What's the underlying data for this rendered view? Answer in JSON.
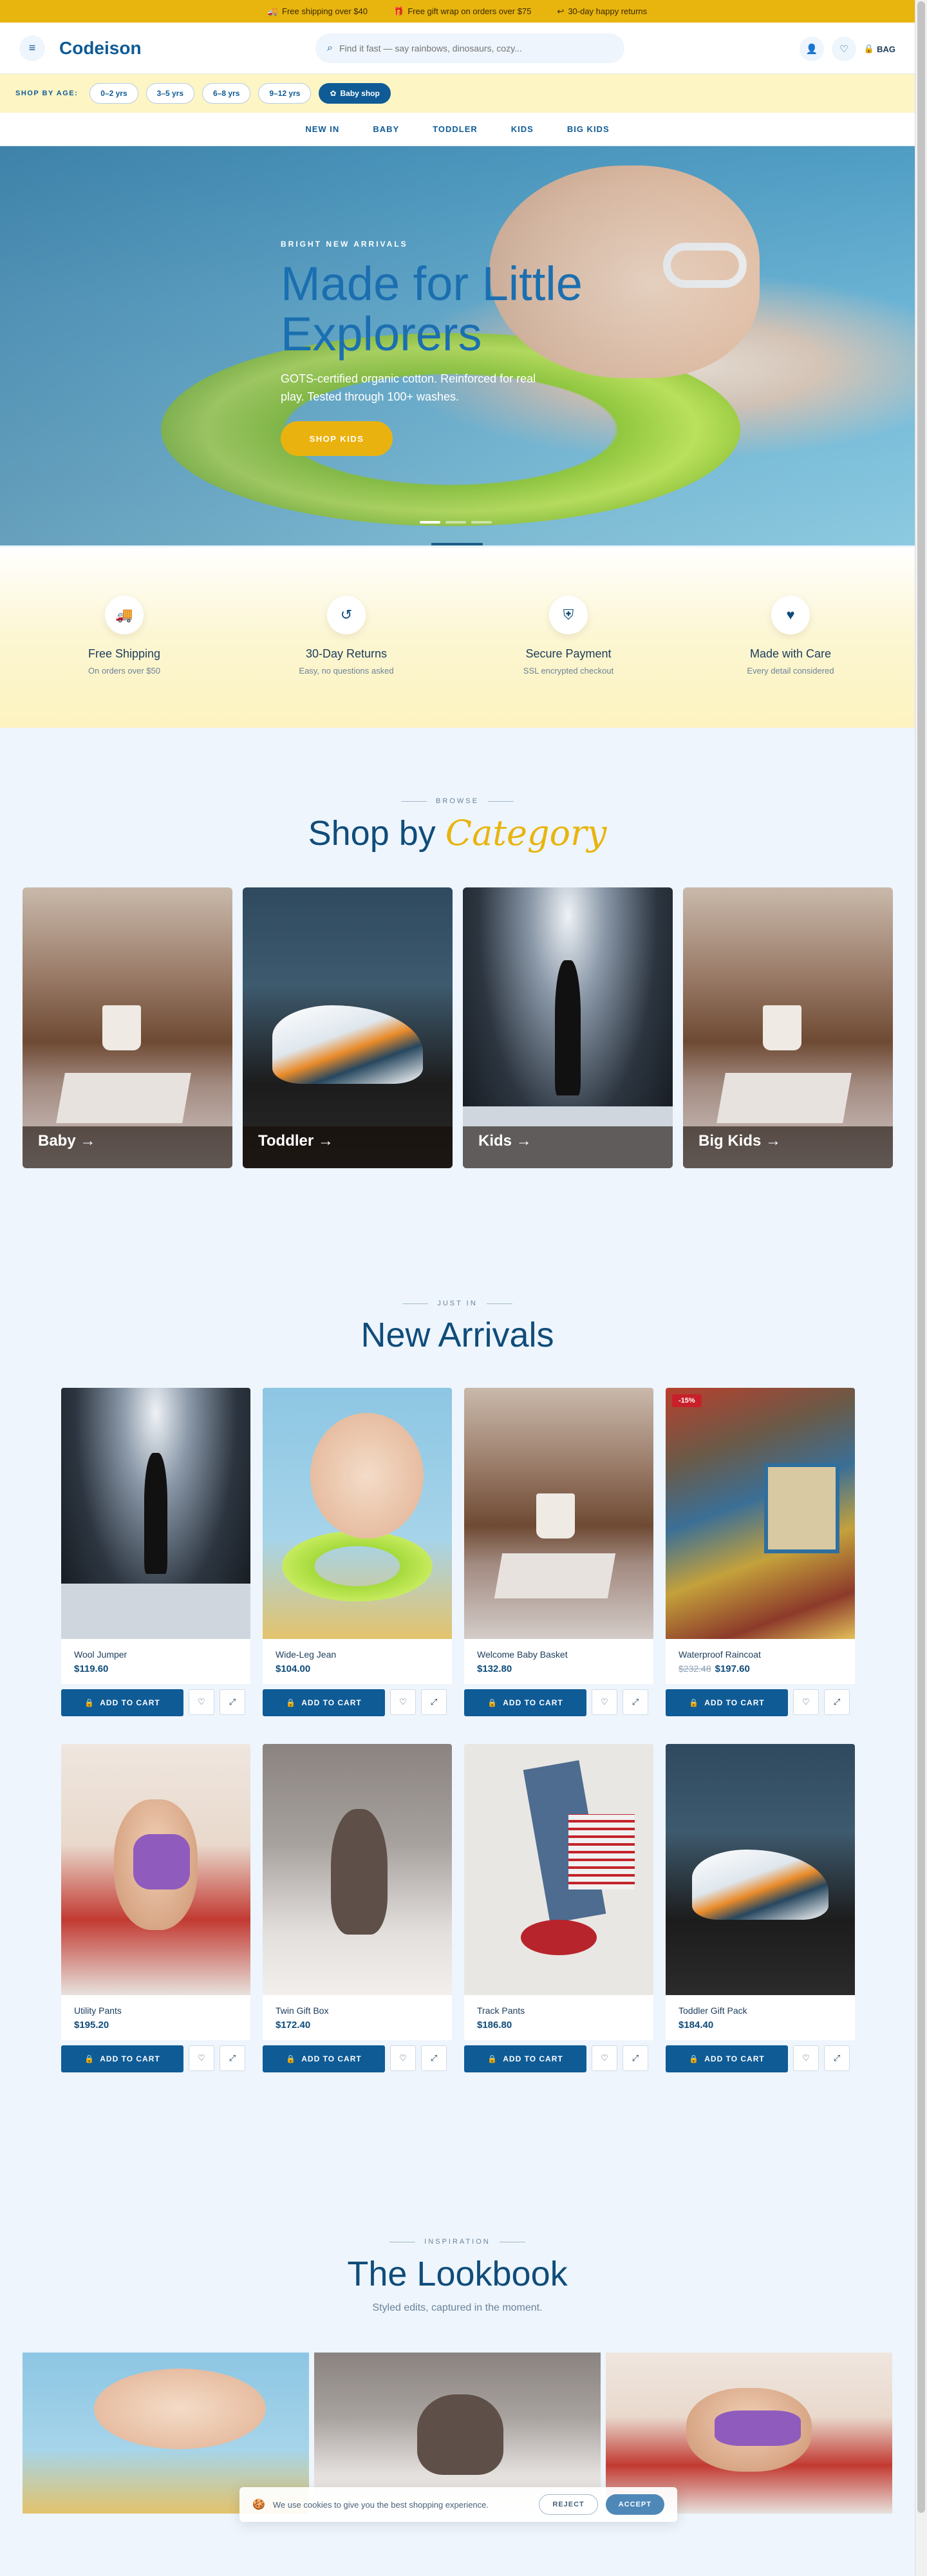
{
  "promo": [
    {
      "icon": "truck-icon",
      "glyph": "🚚",
      "text": "Free shipping over $40"
    },
    {
      "icon": "gift-icon",
      "glyph": "🎁",
      "text": "Free gift wrap on orders over $75"
    },
    {
      "icon": "return-icon",
      "glyph": "↩",
      "text": "30-day happy returns"
    }
  ],
  "header": {
    "logo": "Codeison",
    "search_placeholder": "Find it fast — say rainbows, dinosaurs, cozy...",
    "bag_label": "BAG"
  },
  "agebar": {
    "label": "SHOP BY AGE:",
    "pills": [
      "0–2 yrs",
      "3–5 yrs",
      "6–8 yrs",
      "9–12 yrs"
    ],
    "baby_shop": "Baby shop"
  },
  "nav": [
    "NEW IN",
    "BABY",
    "TODDLER",
    "KIDS",
    "BIG KIDS"
  ],
  "hero": {
    "eyebrow": "BRIGHT NEW ARRIVALS",
    "title_line1": "Made for Little",
    "title_line2": "Explorers",
    "subtitle": "GOTS-certified organic cotton. Reinforced for real play. Tested through 100+ washes.",
    "cta": "SHOP KIDS",
    "slides": 3,
    "active_slide": 1
  },
  "features": [
    {
      "icon": "truck-icon",
      "glyph": "🚚",
      "title": "Free Shipping",
      "sub": "On orders over $50"
    },
    {
      "icon": "return-icon",
      "glyph": "↺",
      "title": "30-Day Returns",
      "sub": "Easy, no questions asked"
    },
    {
      "icon": "shield-icon",
      "glyph": "⛨",
      "title": "Secure Payment",
      "sub": "SSL encrypted checkout"
    },
    {
      "icon": "heart-icon",
      "glyph": "♥",
      "title": "Made with Care",
      "sub": "Every detail considered"
    }
  ],
  "categories_section": {
    "eyebrow": "BROWSE",
    "title": "Shop by",
    "title_accent": "Category",
    "items": [
      {
        "label": "Baby →"
      },
      {
        "label": "Toddler →"
      },
      {
        "label": "Kids →"
      },
      {
        "label": "Big Kids →"
      }
    ]
  },
  "arrivals_section": {
    "eyebrow": "JUST IN",
    "title": "New Arrivals",
    "add_label": "ADD TO CART",
    "products": [
      {
        "name": "Wool Jumper",
        "price": "$119.60",
        "old_price": "",
        "badge": ""
      },
      {
        "name": "Wide-Leg Jean",
        "price": "$104.00",
        "old_price": "",
        "badge": ""
      },
      {
        "name": "Welcome Baby Basket",
        "price": "$132.80",
        "old_price": "",
        "badge": ""
      },
      {
        "name": "Waterproof Raincoat",
        "price": "$197.60",
        "old_price": "$232.48",
        "badge": "-15%"
      },
      {
        "name": "Utility Pants",
        "price": "$195.20",
        "old_price": "",
        "badge": ""
      },
      {
        "name": "Twin Gift Box",
        "price": "$172.40",
        "old_price": "",
        "badge": ""
      },
      {
        "name": "Track Pants",
        "price": "$186.80",
        "old_price": "",
        "badge": ""
      },
      {
        "name": "Toddler Gift Pack",
        "price": "$184.40",
        "old_price": "",
        "badge": ""
      }
    ]
  },
  "lookbook_section": {
    "eyebrow": "INSPIRATION",
    "title": "The Lookbook",
    "subtitle": "Styled edits, captured in the moment."
  },
  "cookie": {
    "text": "We use cookies to give you the best shopping experience.",
    "reject": "REJECT",
    "accept": "ACCEPT"
  },
  "colors": {
    "brand_blue": "#0f5b96",
    "accent_yellow": "#e8b40e",
    "sale_red": "#c8202a"
  }
}
